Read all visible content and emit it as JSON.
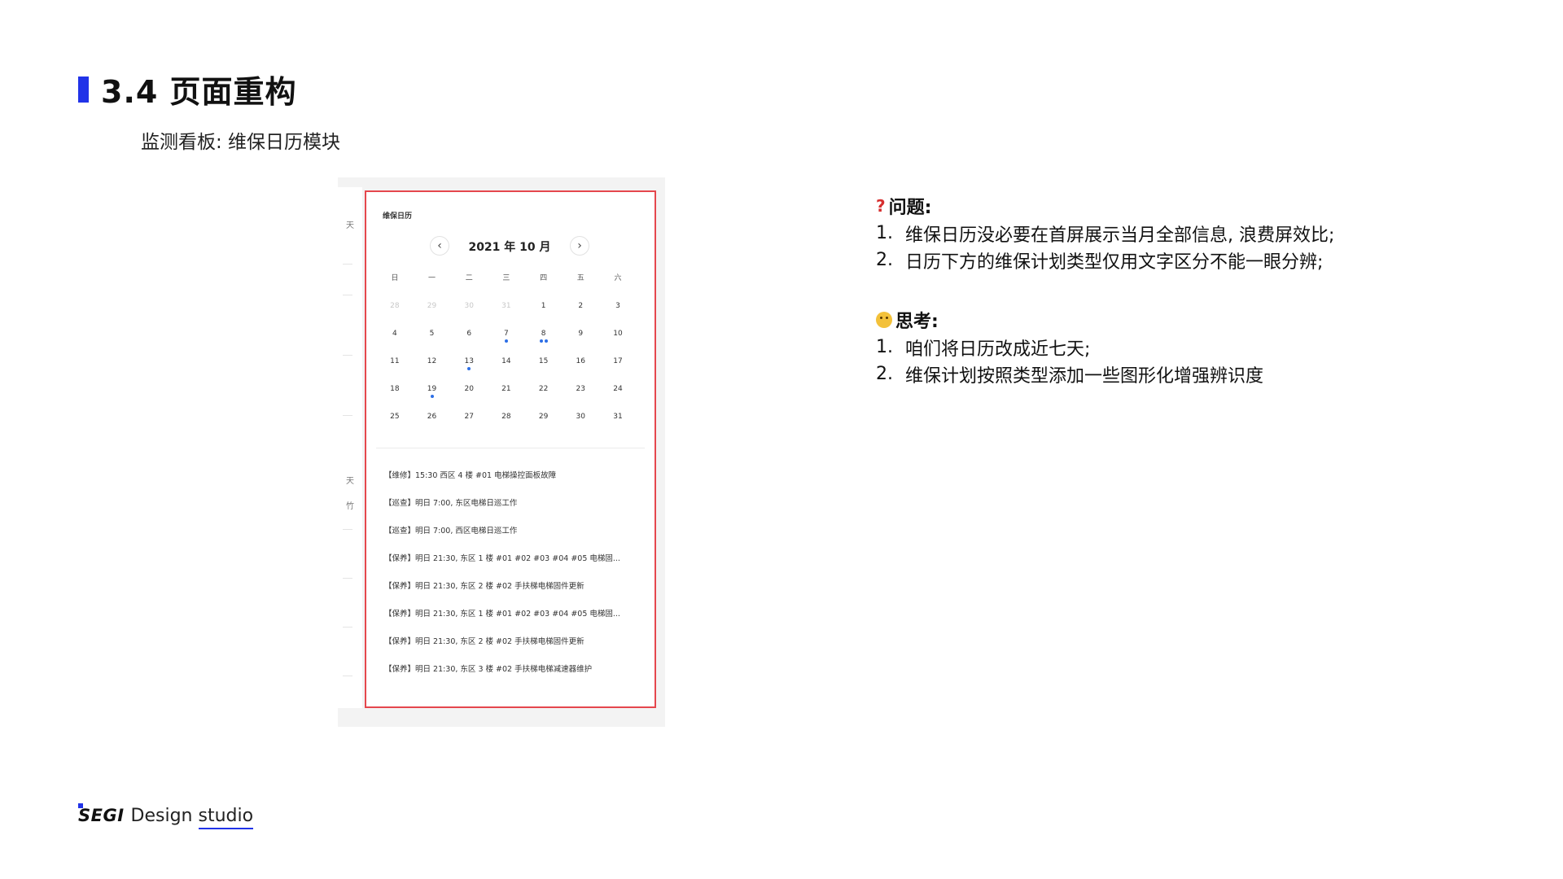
{
  "slide": {
    "title": "3.4 页面重构",
    "subtitle": "监测看板: 维保日历模块",
    "accent_color": "#2133e8"
  },
  "screenshot": {
    "side_labels": [
      "天",
      "天",
      "竹"
    ],
    "card_title": "维保日历",
    "prev_icon": "chevron-left-icon",
    "next_icon": "chevron-right-icon",
    "prev_glyph": "‹",
    "next_glyph": "›",
    "month_label": "2021 年 10 月",
    "weekdays": [
      "日",
      "一",
      "二",
      "三",
      "四",
      "五",
      "六"
    ],
    "weeks": [
      [
        {
          "d": "28",
          "m": true,
          "dots": 0
        },
        {
          "d": "29",
          "m": true,
          "dots": 0
        },
        {
          "d": "30",
          "m": true,
          "dots": 0
        },
        {
          "d": "31",
          "m": true,
          "dots": 0
        },
        {
          "d": "1",
          "m": false,
          "dots": 0
        },
        {
          "d": "2",
          "m": false,
          "dots": 0
        },
        {
          "d": "3",
          "m": false,
          "dots": 0
        }
      ],
      [
        {
          "d": "4",
          "m": false,
          "dots": 0
        },
        {
          "d": "5",
          "m": false,
          "dots": 0
        },
        {
          "d": "6",
          "m": false,
          "dots": 0
        },
        {
          "d": "7",
          "m": false,
          "dots": 1
        },
        {
          "d": "8",
          "m": false,
          "dots": 2
        },
        {
          "d": "9",
          "m": false,
          "dots": 0
        },
        {
          "d": "10",
          "m": false,
          "dots": 0
        }
      ],
      [
        {
          "d": "11",
          "m": false,
          "dots": 0
        },
        {
          "d": "12",
          "m": false,
          "dots": 0
        },
        {
          "d": "13",
          "m": false,
          "dots": 1
        },
        {
          "d": "14",
          "m": false,
          "dots": 0
        },
        {
          "d": "15",
          "m": false,
          "dots": 0
        },
        {
          "d": "16",
          "m": false,
          "dots": 0
        },
        {
          "d": "17",
          "m": false,
          "dots": 0
        }
      ],
      [
        {
          "d": "18",
          "m": false,
          "dots": 0
        },
        {
          "d": "19",
          "m": false,
          "dots": 1
        },
        {
          "d": "20",
          "m": false,
          "dots": 0
        },
        {
          "d": "21",
          "m": false,
          "dots": 0
        },
        {
          "d": "22",
          "m": false,
          "dots": 0
        },
        {
          "d": "23",
          "m": false,
          "dots": 0
        },
        {
          "d": "24",
          "m": false,
          "dots": 0
        }
      ],
      [
        {
          "d": "25",
          "m": false,
          "dots": 0
        },
        {
          "d": "26",
          "m": false,
          "dots": 0
        },
        {
          "d": "27",
          "m": false,
          "dots": 0
        },
        {
          "d": "28",
          "m": false,
          "dots": 0
        },
        {
          "d": "29",
          "m": false,
          "dots": 0
        },
        {
          "d": "30",
          "m": false,
          "dots": 0
        },
        {
          "d": "31",
          "m": false,
          "dots": 0
        }
      ]
    ],
    "events": [
      "【维修】15:30 西区 4 楼 #01 电梯操控面板故障",
      "【巡查】明日 7:00, 东区电梯日巡工作",
      "【巡查】明日 7:00, 西区电梯日巡工作",
      "【保养】明日 21:30, 东区 1 楼 #01 #02 #03 #04 #05 电梯固...",
      "【保养】明日 21:30, 东区 2 楼 #02 手扶梯电梯固件更新",
      "【保养】明日 21:30, 东区 1 楼 #01 #02 #03 #04 #05 电梯固...",
      "【保养】明日 21:30, 东区 2 楼 #02 手扶梯电梯固件更新",
      "【保养】明日 21:30, 东区 3 楼 #02 手扶梯电梯减速器维护"
    ],
    "highlight_color": "#e5474d",
    "dot_color": "#2d6fe6"
  },
  "analysis": {
    "problem_icon_glyph": "?",
    "problem_heading": "问题:",
    "problems": [
      {
        "num": "1.",
        "text": "维保日历没必要在首屏展示当月全部信息, 浪费屏效比;"
      },
      {
        "num": "2.",
        "text": "日历下方的维保计划类型仅用文字区分不能一眼分辨;"
      }
    ],
    "think_heading": "思考:",
    "thoughts": [
      {
        "num": "1.",
        "text": "咱们将日历改成近七天;"
      },
      {
        "num": "2.",
        "text": "维保计划按照类型添加一些图形化增强辨识度"
      }
    ]
  },
  "footer": {
    "logo": "SEGI",
    "studio_prefix": "Design",
    "studio_underlined": "studio"
  }
}
